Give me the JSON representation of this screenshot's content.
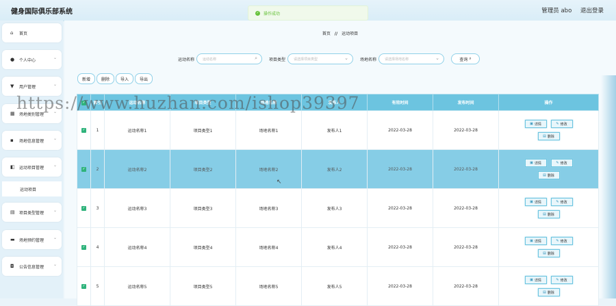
{
  "app": {
    "title": "健身国际俱乐部系统"
  },
  "header": {
    "user_label": "管理员 abo",
    "logout_label": "退出登录"
  },
  "toast": {
    "message": "操作成功"
  },
  "sidebar": {
    "items": [
      {
        "label": "首页",
        "icon": "home-icon",
        "glyph": "⌂"
      },
      {
        "label": "个人中心",
        "icon": "person-icon",
        "glyph": "●"
      },
      {
        "label": "用户管理",
        "icon": "user-manage-icon",
        "glyph": "▼"
      },
      {
        "label": "场地类别管理",
        "icon": "category-icon",
        "glyph": "▦"
      },
      {
        "label": "场地信息管理",
        "icon": "grid-icon",
        "glyph": "▪"
      },
      {
        "label": "运动项目管理",
        "icon": "sport-icon",
        "glyph": "◧"
      },
      {
        "label": "项目类型管理",
        "icon": "type-icon",
        "glyph": "▤"
      },
      {
        "label": "场地预约管理",
        "icon": "booking-icon",
        "glyph": "▬"
      },
      {
        "label": "公告信息管理",
        "icon": "notice-icon",
        "glyph": "◘"
      }
    ],
    "sub_item": "运动项目"
  },
  "breadcrumb": {
    "home": "首页",
    "sep": "//",
    "current": "运动项目"
  },
  "search": {
    "name_label": "运动名称",
    "name_placeholder": "运动名称",
    "type_label": "项目类型",
    "type_placeholder": "请选择项目类型",
    "venue_label": "场地名称",
    "venue_placeholder": "请选择场地名称",
    "button": "查询"
  },
  "actions": {
    "add": "新增",
    "delete": "删除",
    "import": "导入",
    "export": "导出"
  },
  "table": {
    "headers": [
      "索引",
      "运动名称",
      "项目类型",
      "场地名称",
      "发布人",
      "有效时间",
      "发布时间",
      "操作"
    ],
    "rows": [
      {
        "index": "1",
        "name": "运动名称1",
        "type": "项目类型1",
        "venue": "场地名称1",
        "publisher": "发布人1",
        "valid": "2022-03-28",
        "published": "2022-03-28"
      },
      {
        "index": "2",
        "name": "运动名称2",
        "type": "项目类型2",
        "venue": "场地名称2",
        "publisher": "发布人2",
        "valid": "2022-03-28",
        "published": "2022-03-28"
      },
      {
        "index": "3",
        "name": "运动名称3",
        "type": "项目类型3",
        "venue": "场地名称3",
        "publisher": "发布人3",
        "valid": "2022-03-28",
        "published": "2022-03-28"
      },
      {
        "index": "4",
        "name": "运动名称4",
        "type": "项目类型4",
        "venue": "场地名称4",
        "publisher": "发布人4",
        "valid": "2022-03-28",
        "published": "2022-03-28"
      },
      {
        "index": "5",
        "name": "运动名称5",
        "type": "项目类型5",
        "venue": "场地名称5",
        "publisher": "发布人5",
        "valid": "2022-03-28",
        "published": "2022-03-28"
      }
    ],
    "op_detail": "详情",
    "op_edit": "修改",
    "op_delete": "删除"
  },
  "watermark": "https://www.huzhan.com/ishop39397",
  "colors": {
    "accent": "#6cc4e0",
    "selected_row": "#86cde6",
    "checkbox": "#2fb37b"
  }
}
